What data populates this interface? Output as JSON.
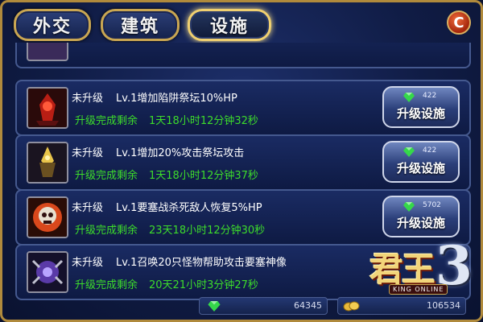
{
  "tabs": [
    {
      "label": "外交",
      "active": false
    },
    {
      "label": "建筑",
      "active": false
    },
    {
      "label": "设施",
      "active": true
    }
  ],
  "close_icon": "close-icon",
  "rows": [
    {
      "status": "未升级",
      "description": "Lv.1增加陷阱祭坛10%HP",
      "timer_label": "升级完成剩余",
      "timer": "1天18小时12分钟32秒",
      "cost": "422",
      "button_label": "升级设施",
      "icon": "red-altar-icon"
    },
    {
      "status": "未升级",
      "description": "Lv.1增加20%攻击祭坛攻击",
      "timer_label": "升级完成剩余",
      "timer": "1天18小时12分钟37秒",
      "cost": "422",
      "button_label": "升级设施",
      "icon": "gold-altar-icon"
    },
    {
      "status": "未升级",
      "description": "Lv.1要塞战杀死敌人恢复5%HP",
      "timer_label": "升级完成剩余",
      "timer": "23天18小时12分钟30秒",
      "cost": "5702",
      "button_label": "升级设施",
      "icon": "skull-icon"
    },
    {
      "status": "未升级",
      "description": "Lv.1召唤20只怪物帮助攻击要塞神像",
      "timer_label": "升级完成剩余",
      "timer": "20天21小时3分钟27秒",
      "cost": "",
      "button_label": "",
      "icon": "summon-statue-icon"
    }
  ],
  "bottom": {
    "gems": "64345",
    "gold": "106534"
  },
  "logo": {
    "main": "君王",
    "number": "3",
    "sub": "KING ONLINE"
  },
  "colors": {
    "timer_green": "#3ddc2b",
    "frame_gold": "#b08a3c",
    "gem_green": "#35d84a"
  }
}
